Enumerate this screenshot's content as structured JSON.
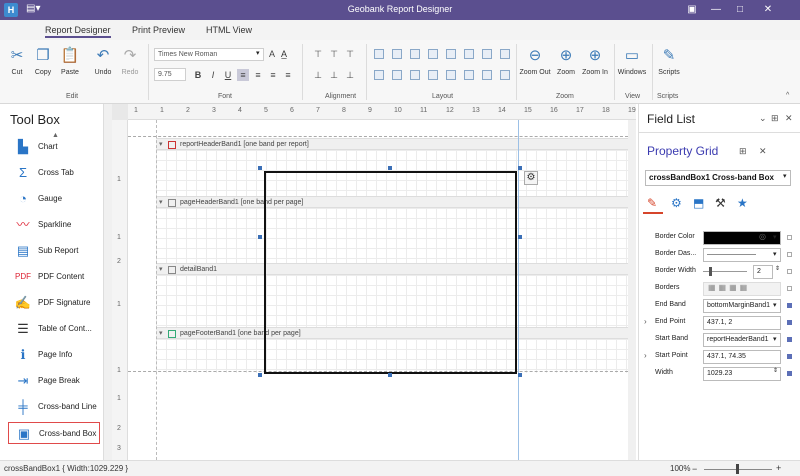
{
  "window": {
    "title": "Geobank Report Designer",
    "app_icon": "H"
  },
  "tabs": [
    {
      "label": "Report Designer"
    },
    {
      "label": "Print Preview"
    },
    {
      "label": "HTML View"
    }
  ],
  "ribbon": {
    "edit": {
      "group": "Edit",
      "cut": "Cut",
      "copy": "Copy",
      "paste": "Paste",
      "undo": "Undo",
      "redo": "Redo"
    },
    "font": {
      "group": "Font",
      "family": "Times New Roman",
      "size": "9.75"
    },
    "alignment": {
      "group": "Alignment"
    },
    "layout": {
      "group": "Layout"
    },
    "zoom": {
      "group": "Zoom",
      "zoom_out": "Zoom Out",
      "zoom": "Zoom",
      "zoom_in": "Zoom In"
    },
    "view": {
      "group": "View",
      "windows": "Windows"
    },
    "scripts": {
      "group": "Scripts",
      "scripts": "Scripts"
    }
  },
  "toolbox": {
    "title": "Tool Box",
    "items": [
      {
        "label": "Chart",
        "icon": "chart-icon"
      },
      {
        "label": "Cross Tab",
        "icon": "sigma-icon"
      },
      {
        "label": "Gauge",
        "icon": "gauge-icon"
      },
      {
        "label": "Sparkline",
        "icon": "sparkline-icon"
      },
      {
        "label": "Sub Report",
        "icon": "subreport-icon"
      },
      {
        "label": "PDF Content",
        "icon": "pdf-icon"
      },
      {
        "label": "PDF Signature",
        "icon": "signature-icon"
      },
      {
        "label": "Table of Cont...",
        "icon": "toc-icon"
      },
      {
        "label": "Page Info",
        "icon": "pageinfo-icon"
      },
      {
        "label": "Page Break",
        "icon": "pagebreak-icon"
      },
      {
        "label": "Cross-band Line",
        "icon": "crossband-line-icon"
      },
      {
        "label": "Cross-band Box",
        "icon": "crossband-box-icon"
      }
    ]
  },
  "rulers": {
    "h": [
      "1",
      "1",
      "2",
      "3",
      "4",
      "5",
      "6",
      "7",
      "8",
      "9",
      "10",
      "11",
      "12",
      "13",
      "14",
      "15",
      "16",
      "17",
      "18",
      "19"
    ],
    "v": [
      "1",
      "1",
      "2",
      "1",
      "1",
      "1",
      "2",
      "3"
    ]
  },
  "bands": {
    "report_header": "reportHeaderBand1 [one band per report]",
    "page_header": "pageHeaderBand1 [one band per page]",
    "detail": "detailBand1",
    "page_footer": "pageFooterBand1 [one band per page]"
  },
  "field_list": {
    "title": "Field List"
  },
  "property_grid": {
    "title": "Property Grid",
    "selector": "crossBandBox1  Cross-band Box",
    "rows": [
      {
        "name": "Border Color",
        "value": ""
      },
      {
        "name": "Border Das...",
        "value": "———————"
      },
      {
        "name": "Border Width",
        "value": "2"
      },
      {
        "name": "Borders",
        "value": ""
      },
      {
        "name": "End Band",
        "value": "bottomMarginBand1"
      },
      {
        "name": "End Point",
        "value": "437.1, 2"
      },
      {
        "name": "Start Band",
        "value": "reportHeaderBand1"
      },
      {
        "name": "Start Point",
        "value": "437.1, 74.35"
      },
      {
        "name": "Width",
        "value": "1029.23"
      }
    ]
  },
  "status": {
    "left": "crossBandBox1 { Width:1029.229 }",
    "zoom": "100%"
  },
  "colors": {
    "titlebar": "#5b4f8f",
    "accent": "#2a75c6",
    "selection_border": "#e04a4a"
  }
}
